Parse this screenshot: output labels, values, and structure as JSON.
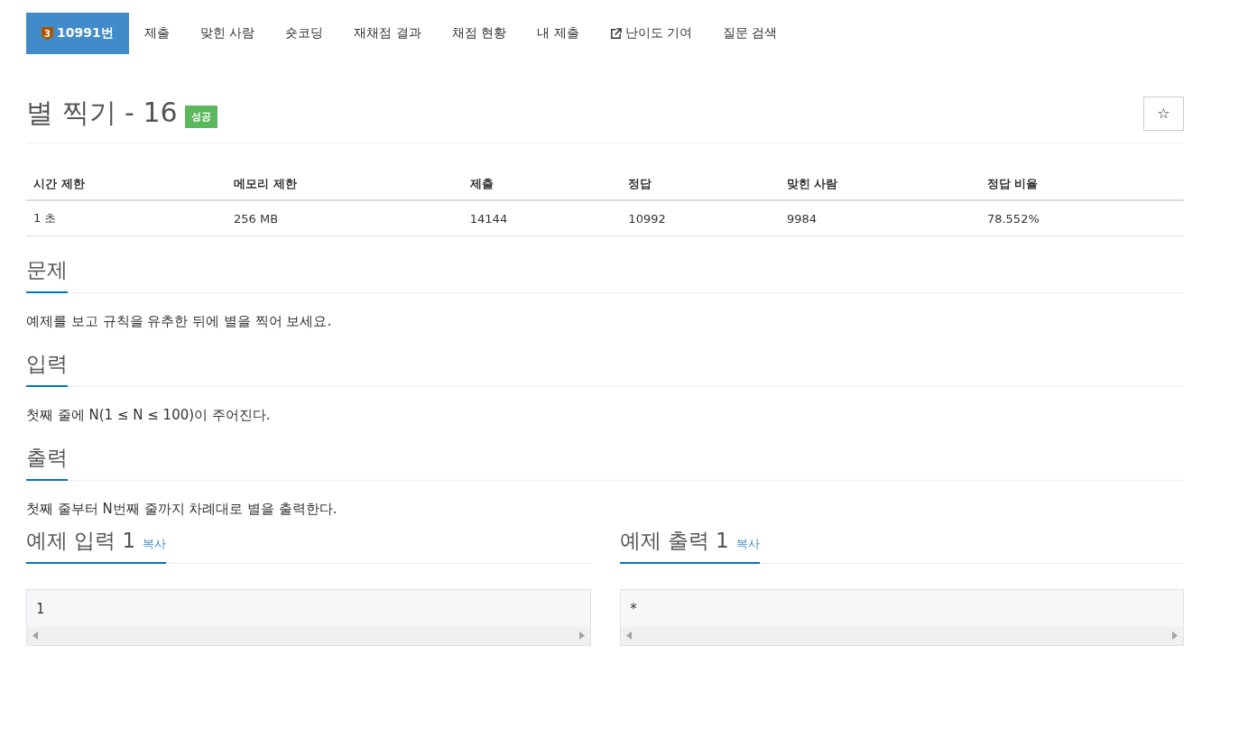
{
  "nav": [
    {
      "label": "10991번",
      "kind": "tier",
      "badge": "3",
      "selected": true
    },
    {
      "label": "제출",
      "kind": "plain",
      "selected": false
    },
    {
      "label": "맞힌 사람",
      "kind": "plain",
      "selected": false
    },
    {
      "label": "숏코딩",
      "kind": "plain",
      "selected": false
    },
    {
      "label": "재채점 결과",
      "kind": "plain",
      "selected": false
    },
    {
      "label": "채점 현황",
      "kind": "plain",
      "selected": false
    },
    {
      "label": "내 제출",
      "kind": "plain",
      "selected": false
    },
    {
      "label": "난이도 기여",
      "kind": "external",
      "selected": false
    },
    {
      "label": "질문 검색",
      "kind": "plain",
      "selected": false
    }
  ],
  "title": {
    "text": "별 찍기 - 16",
    "status": "성공",
    "favorite": "☆"
  },
  "stats": {
    "columns": [
      "시간 제한",
      "메모리 제한",
      "제출",
      "정답",
      "맞힌 사람",
      "정답 비율"
    ],
    "row": [
      "1 초",
      "256 MB",
      "14144",
      "10992",
      "9984",
      "78.552%"
    ]
  },
  "sections": [
    {
      "heading": "문제",
      "text": "예제를 보고 규칙을 유추한 뒤에 별을 찍어 보세요."
    },
    {
      "heading": "입력",
      "text": "첫째 줄에 N(1 ≤ N ≤ 100)이 주어진다."
    },
    {
      "heading": "출력",
      "text": "첫째 줄부터 N번째 줄까지 차례대로 별을 출력한다."
    }
  ],
  "samples": [
    {
      "heading": "예제 입력 1",
      "copy": "복사",
      "code": "1"
    },
    {
      "heading": "예제 출력 1",
      "copy": "복사",
      "code": "*"
    }
  ]
}
